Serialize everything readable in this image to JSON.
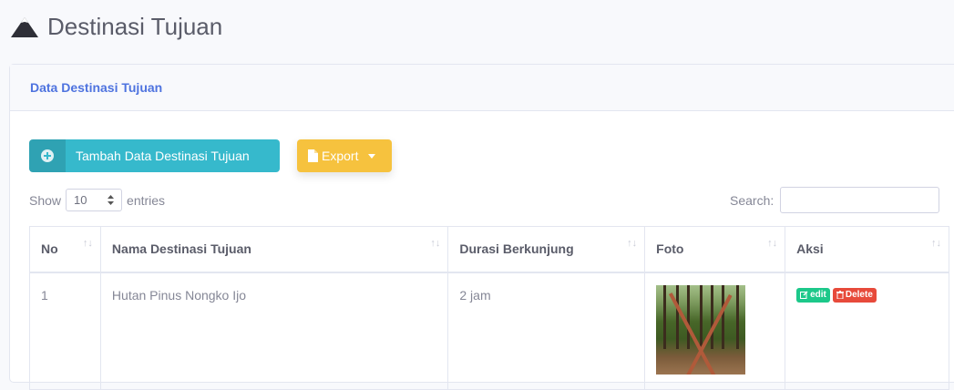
{
  "header": {
    "title": "Destinasi Tujuan",
    "icon": "mountain-icon"
  },
  "card": {
    "title": "Data Destinasi Tujuan"
  },
  "toolbar": {
    "add_label": "Tambah Data Destinasi Tujuan",
    "export_label": "Export"
  },
  "entries": {
    "show_label": "Show",
    "value": "10",
    "entries_label": "entries"
  },
  "search": {
    "label": "Search:",
    "value": ""
  },
  "table": {
    "columns": [
      "No",
      "Nama Destinasi Tujuan",
      "Durasi Berkunjung",
      "Foto",
      "Aksi"
    ],
    "rows": [
      {
        "no": "1",
        "nama": "Hutan Pinus Nongko Ijo",
        "durasi": "2 jam"
      }
    ],
    "actions": {
      "edit_label": "edit",
      "delete_label": "Delete"
    }
  },
  "colors": {
    "primary": "#4e73df",
    "info": "#36b9cc",
    "warning": "#f6c23e",
    "success": "#1cc88a",
    "danger": "#e74a3b"
  }
}
